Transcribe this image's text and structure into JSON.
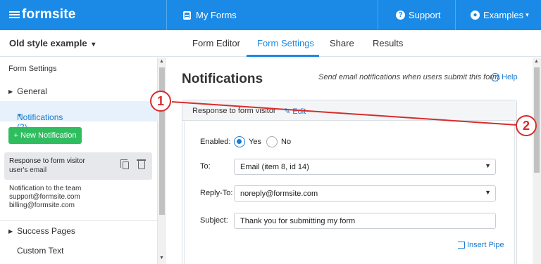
{
  "topbar": {
    "brand": "formsite",
    "my_forms": "My Forms",
    "support": "Support",
    "examples": "Examples",
    "examples_caret": "▾"
  },
  "subbar": {
    "form_name": "Old style example",
    "form_caret": "▾",
    "tabs": [
      "Form Editor",
      "Form Settings",
      "Share",
      "Results"
    ],
    "active_tab": "Form Settings"
  },
  "sidebar": {
    "heading": "Form Settings",
    "general": "General",
    "notifications": "Notifications (2)",
    "new_notification": "+ New Notification",
    "notification_items": [
      {
        "title": "Response to form visitor",
        "subtitle": "user's email"
      },
      {
        "title": "Notification to the team",
        "line1": "support@formsite.com",
        "line2": "billing@formsite.com"
      }
    ],
    "success_pages": "Success Pages",
    "custom_text": "Custom Text"
  },
  "main": {
    "title": "Notifications",
    "description": "Send email notifications when users submit this form.",
    "help": "Help",
    "panel_title": "Response to form visitor",
    "edit": "Edit",
    "enabled_label": "Enabled:",
    "yes": "Yes",
    "no": "No",
    "enabled_value": "Yes",
    "to_label": "To:",
    "to_value": "Email (item 8, id 14)",
    "reply_to_label": "Reply-To:",
    "reply_to_value": "noreply@formsite.com",
    "subject_label": "Subject:",
    "subject_value": "Thank you for submitting my form",
    "insert_pipe": "Insert Pipe"
  },
  "annotations": {
    "marker1": "1",
    "marker2": "2",
    "line_color": "#d92b2b"
  },
  "colors": {
    "brand_blue": "#1a8ae6",
    "accent_green": "#2fbd60"
  }
}
